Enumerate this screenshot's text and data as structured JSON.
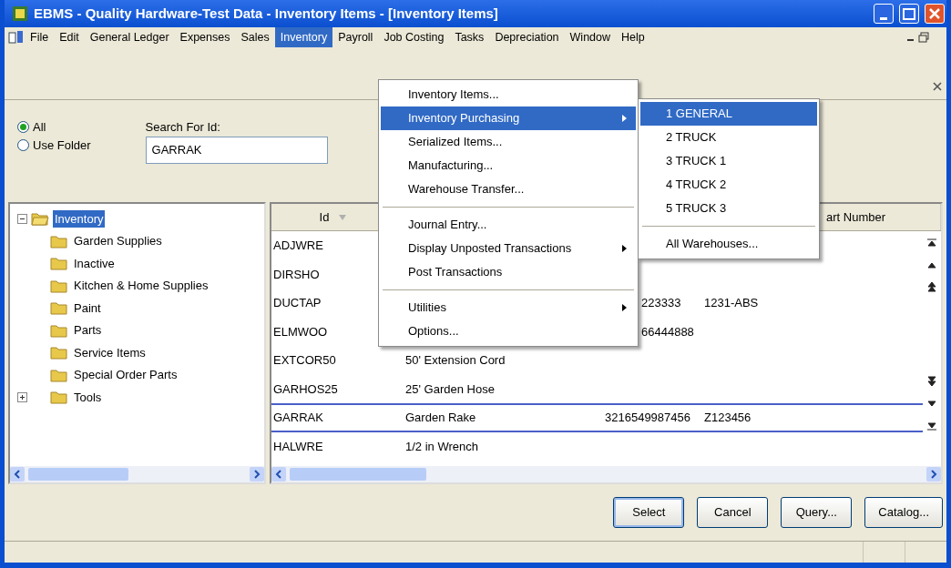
{
  "window": {
    "title": "EBMS - Quality Hardware-Test Data - Inventory Items - [Inventory Items]"
  },
  "menu_bar": [
    {
      "label": "File",
      "selected": false
    },
    {
      "label": "Edit",
      "selected": false
    },
    {
      "label": "General Ledger",
      "selected": false
    },
    {
      "label": "Expenses",
      "selected": false
    },
    {
      "label": "Sales",
      "selected": false
    },
    {
      "label": "Inventory",
      "selected": true
    },
    {
      "label": "Payroll",
      "selected": false
    },
    {
      "label": "Job Costing",
      "selected": false
    },
    {
      "label": "Tasks",
      "selected": false
    },
    {
      "label": "Depreciation",
      "selected": false
    },
    {
      "label": "Window",
      "selected": false
    },
    {
      "label": "Help",
      "selected": false
    }
  ],
  "inventory_menu": [
    {
      "kind": "item",
      "label": "Inventory Items...",
      "selected": false,
      "submenu": false
    },
    {
      "kind": "item",
      "label": "Inventory Purchasing",
      "selected": true,
      "submenu": true
    },
    {
      "kind": "item",
      "label": "Serialized Items...",
      "selected": false,
      "submenu": false
    },
    {
      "kind": "item",
      "label": "Manufacturing...",
      "selected": false,
      "submenu": false
    },
    {
      "kind": "item",
      "label": "Warehouse Transfer...",
      "selected": false,
      "submenu": false
    },
    {
      "kind": "separator"
    },
    {
      "kind": "item",
      "label": "Journal Entry...",
      "selected": false,
      "submenu": false
    },
    {
      "kind": "item",
      "label": "Display Unposted Transactions",
      "selected": false,
      "submenu": true
    },
    {
      "kind": "item",
      "label": "Post Transactions",
      "selected": false,
      "submenu": false
    },
    {
      "kind": "separator"
    },
    {
      "kind": "item",
      "label": "Utilities",
      "selected": false,
      "submenu": true
    },
    {
      "kind": "item",
      "label": "Options...",
      "selected": false,
      "submenu": false
    }
  ],
  "purchasing_submenu": [
    {
      "kind": "item",
      "label": "1 GENERAL",
      "selected": true
    },
    {
      "kind": "item",
      "label": "2 TRUCK",
      "selected": false
    },
    {
      "kind": "item",
      "label": "3 TRUCK 1",
      "selected": false
    },
    {
      "kind": "item",
      "label": "4 TRUCK 2",
      "selected": false
    },
    {
      "kind": "item",
      "label": "5 TRUCK 3",
      "selected": false
    },
    {
      "kind": "separator"
    },
    {
      "kind": "item",
      "label": "All Warehouses...",
      "selected": false
    }
  ],
  "filter": {
    "options": [
      {
        "label": "All",
        "selected": true
      },
      {
        "label": "Use Folder",
        "selected": false
      }
    ],
    "search_label": "Search For Id:",
    "search_value": "GARRAK"
  },
  "tree": {
    "label": "Inventory",
    "selected": true,
    "expanded": true,
    "children": [
      {
        "label": "Garden Supplies",
        "expandable": false
      },
      {
        "label": "Inactive",
        "expandable": false
      },
      {
        "label": "Kitchen & Home Supplies",
        "expandable": false
      },
      {
        "label": "Paint",
        "expandable": false
      },
      {
        "label": "Parts",
        "expandable": false
      },
      {
        "label": "Service Items",
        "expandable": false
      },
      {
        "label": "Special Order Parts",
        "expandable": false
      },
      {
        "label": "Tools",
        "expandable": true
      }
    ]
  },
  "grid": {
    "id_column": {
      "label": "Id",
      "sorted": true
    },
    "column_4": {
      "label": "art Number"
    },
    "rows": [
      {
        "id": "ADJWRE",
        "selected": false
      },
      {
        "id": "DIRSHO",
        "selected": false
      },
      {
        "id": "DUCTAP",
        "column_3": "223333",
        "column_3_clipped": true,
        "column_4": "1231-ABS",
        "selected": false
      },
      {
        "id": "ELMWOO",
        "column_3": "66444888",
        "column_3_clipped": true,
        "selected": false
      },
      {
        "id": "EXTCOR50",
        "description": "50' Extension Cord",
        "selected": false
      },
      {
        "id": "GARHOS25",
        "description": "25' Garden Hose",
        "selected": false
      },
      {
        "id": "GARRAK",
        "description": "Garden Rake",
        "column_3": "3216549987456",
        "column_3_clipped": false,
        "column_4": "Z123456",
        "selected": true
      },
      {
        "id": "HALWRE",
        "description": "1/2 in Wrench",
        "selected": false
      }
    ]
  },
  "buttons": [
    {
      "label": "Select",
      "default": true
    },
    {
      "label": "Cancel",
      "default": false
    },
    {
      "label": "Query...",
      "default": false
    },
    {
      "label": "Catalog...",
      "default": false
    }
  ]
}
